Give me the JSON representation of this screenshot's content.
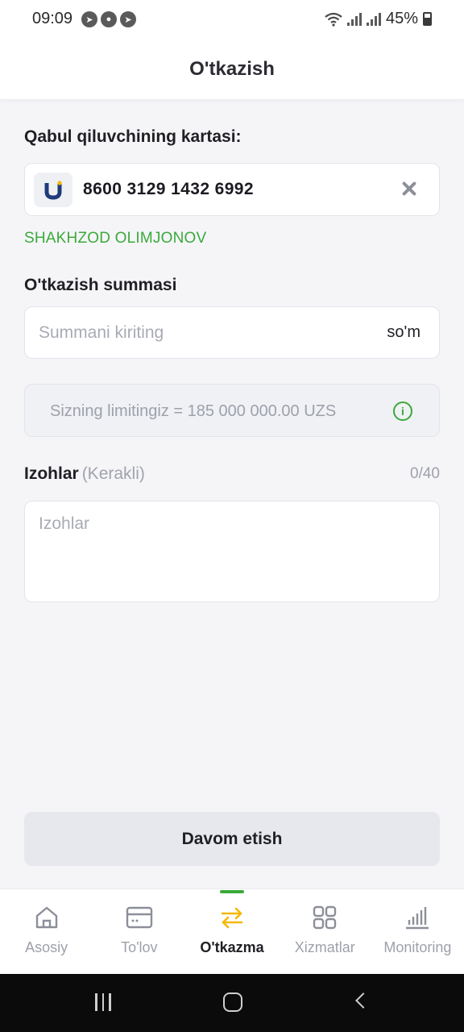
{
  "status_bar": {
    "time": "09:09",
    "battery": "45%"
  },
  "header": {
    "title": "O'tkazish"
  },
  "recipient": {
    "label": "Qabul qiluvchining kartasi:",
    "card_number": "8600 3129 1432 6992",
    "holder_name": "SHAKHZOD OLIMJONOV",
    "bank_logo_letter": "U"
  },
  "amount": {
    "label": "O'tkazish summasi",
    "placeholder": "Summani kiriting",
    "currency": "so'm"
  },
  "limit": {
    "text": "Sizning limitingiz = 185 000 000.00 UZS"
  },
  "notes": {
    "label": "Izohlar",
    "optional_label": "(Kerakli)",
    "counter": "0/40",
    "placeholder": "Izohlar"
  },
  "continue_button": "Davom etish",
  "bottom_nav": {
    "items": [
      {
        "label": "Asosiy",
        "icon": "home-icon"
      },
      {
        "label": "To'lov",
        "icon": "card-icon"
      },
      {
        "label": "O'tkazma",
        "icon": "transfer-icon"
      },
      {
        "label": "Xizmatlar",
        "icon": "grid-icon"
      },
      {
        "label": "Monitoring",
        "icon": "bar-chart-icon"
      }
    ],
    "active_index": 2
  },
  "colors": {
    "accent_green": "#3aaa3a",
    "transfer_yellow": "#f5b800",
    "background": "#f5f5f8"
  }
}
